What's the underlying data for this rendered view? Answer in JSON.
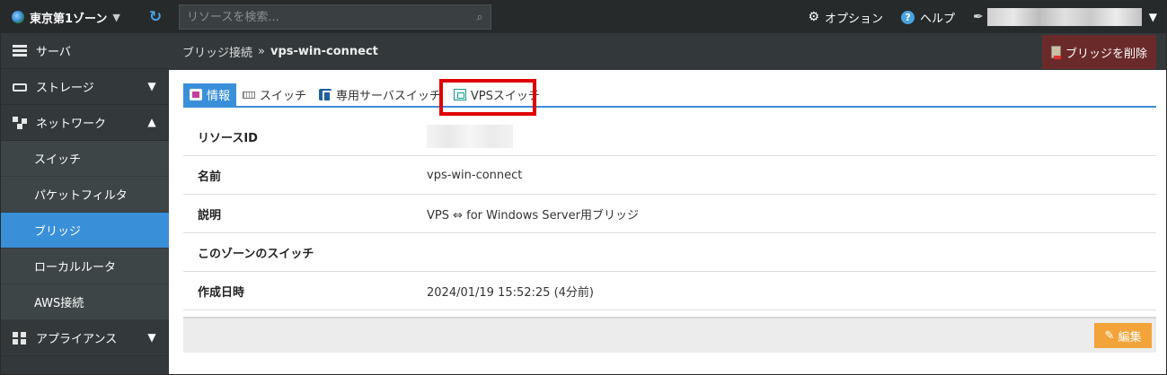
{
  "topbar": {
    "zone": "東京第1ゾーン",
    "search_placeholder": "リソースを検索...",
    "options": "オプション",
    "help": "ヘルプ"
  },
  "sidebar": {
    "items": [
      {
        "label": "サーバ",
        "icon": "server-icon"
      },
      {
        "label": "ストレージ",
        "icon": "storage-icon"
      },
      {
        "label": "ネットワーク",
        "icon": "network-icon"
      }
    ],
    "network_sub": [
      "スイッチ",
      "パケットフィルタ",
      "ブリッジ",
      "ローカルルータ",
      "AWS接続"
    ],
    "active_sub": "ブリッジ",
    "appliance": "アプライアンス"
  },
  "header": {
    "parent": "ブリッジ接続",
    "separator": "»",
    "current": "vps-win-connect",
    "delete_button": "ブリッジを削除"
  },
  "tabs": [
    "情報",
    "スイッチ",
    "専用サーバスイッチ",
    "VPSスイッチ"
  ],
  "details": {
    "resource_id_label": "リソースID",
    "name_label": "名前",
    "name_value": "vps-win-connect",
    "description_label": "説明",
    "description_value": "VPS ⇔ for Windows Server用ブリッジ",
    "zone_switch_label": "このゾーンのスイッチ",
    "created_label": "作成日時",
    "created_value": "2024/01/19 15:52:25 (4分前)"
  },
  "footer": {
    "edit_button": "編集"
  },
  "colors": {
    "accent": "#3a8fd9",
    "highlight": "#e00000",
    "edit": "#f2a43a",
    "delete": "#6b2a2a"
  }
}
